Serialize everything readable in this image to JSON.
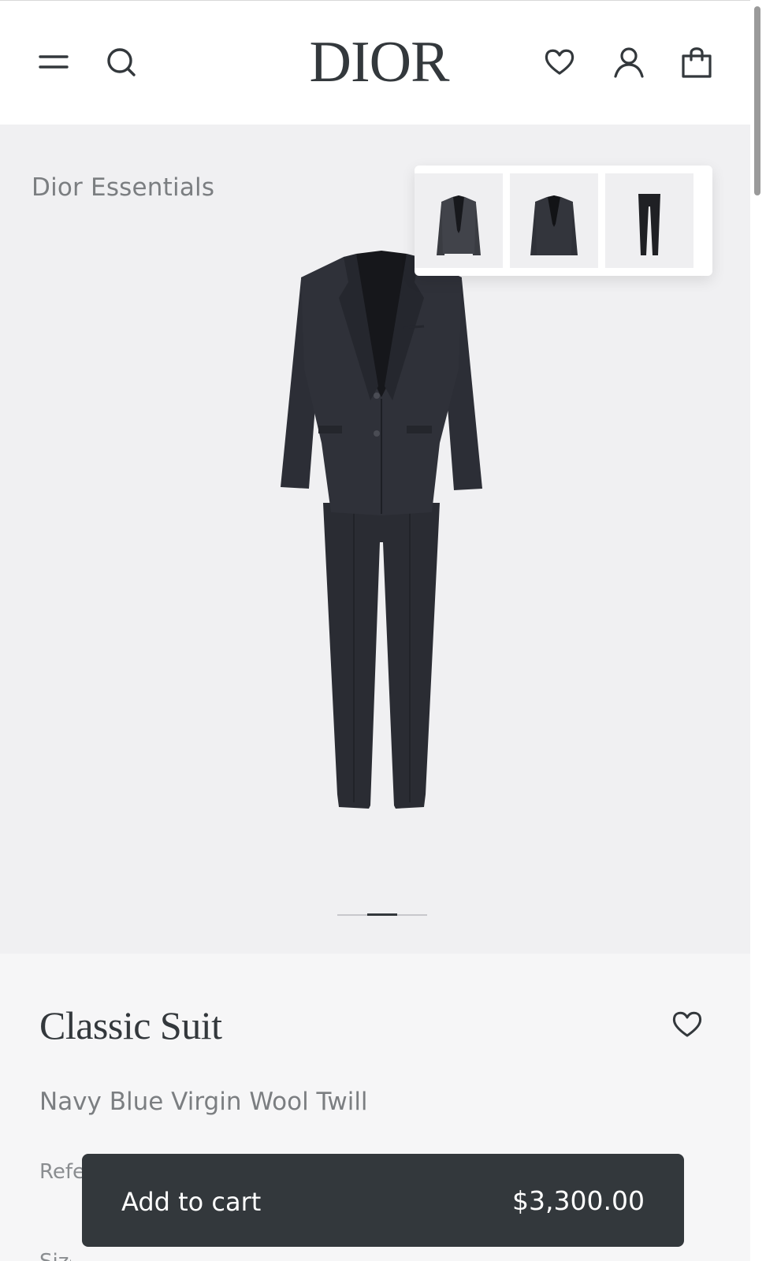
{
  "header": {
    "logo_text": "DIOR",
    "icons": [
      "menu-icon",
      "search-icon",
      "heart-icon",
      "user-icon",
      "shopping-bag-icon"
    ]
  },
  "hero": {
    "collection_label": "Dior Essentials",
    "thumbnails": [
      {
        "name": "jacket front view"
      },
      {
        "name": "jacket back view"
      },
      {
        "name": "trousers"
      }
    ],
    "carousel": {
      "total": 3,
      "current": 2
    }
  },
  "product": {
    "title": "Classic Suit",
    "subtitle": "Navy Blue Virgin Wool Twill",
    "reference_label": "Reference",
    "next_label": "Size"
  },
  "cart": {
    "label": "Add to cart",
    "price": "$3,300.00"
  },
  "colors": {
    "primary_dark": "#33383c",
    "hero_bg": "#f0f0f2",
    "details_bg": "#f6f6f7",
    "muted_text": "#7b7e81"
  }
}
